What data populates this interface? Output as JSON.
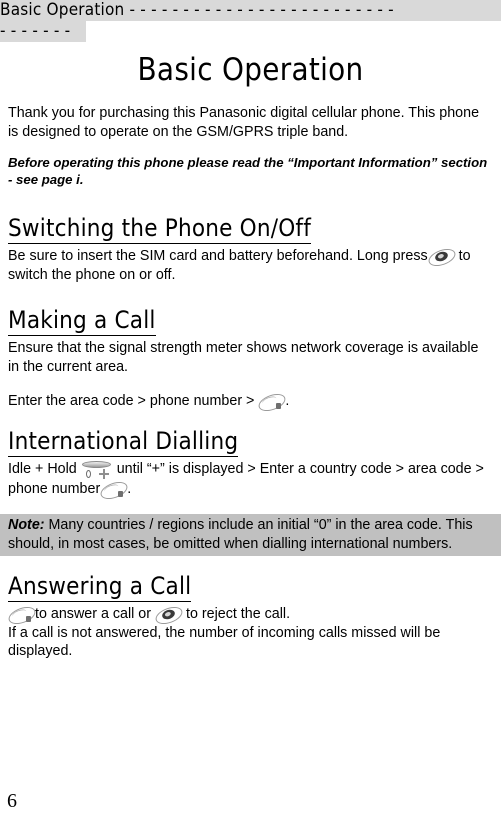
{
  "header": {
    "title": "Basic Operation",
    "rule_line_1": "- - - - - - - - - - - - - - - - - - - - - - - - -",
    "rule_line_2": "- - - - - - -"
  },
  "document": {
    "title": "Basic Operation",
    "intro": "Thank you for purchasing this Panasonic digital cellular phone. This phone is designed to operate on the GSM/GPRS triple band.",
    "notice": "Before operating this phone please read the “Important Information” section - see page i."
  },
  "sections": {
    "switching": {
      "heading": "Switching the Phone On/Off",
      "text_before_icon": "Be sure to insert the SIM card and battery beforehand. Long press",
      "text_after_icon": "to switch the phone on or off."
    },
    "making_call": {
      "heading": "Making a Call",
      "paragraph": "Ensure that the signal strength meter shows network coverage is available in the current area.",
      "step_before_icon": "Enter the area code > phone number >",
      "step_after_icon": "."
    },
    "international": {
      "heading": "International Dialling",
      "step_part_1": "Idle + Hold",
      "step_part_2": "until “+” is displayed > Enter a country code > area code > phone number",
      "step_part_3": ".",
      "note_label": "Note:",
      "note_text": " Many countries / regions include an initial “0” in the area code. This should, in most cases, be omitted when dialling international numbers."
    },
    "answering": {
      "heading": "Answering a Call",
      "line_1_part_1": "to answer a call or",
      "line_1_part_2": "to reject the call.",
      "line_2": "If a call is not answered, the number of incoming calls missed will be displayed."
    }
  },
  "footer": {
    "page_number": "6"
  },
  "icons": {
    "send_key": "send-call-key-icon",
    "end_key": "end-power-key-icon",
    "zero_plus_key": "zero-plus-key-icon"
  },
  "colors": {
    "header_band": "#d9d9d9",
    "note_band": "#c0c0c0",
    "text": "#000000"
  }
}
